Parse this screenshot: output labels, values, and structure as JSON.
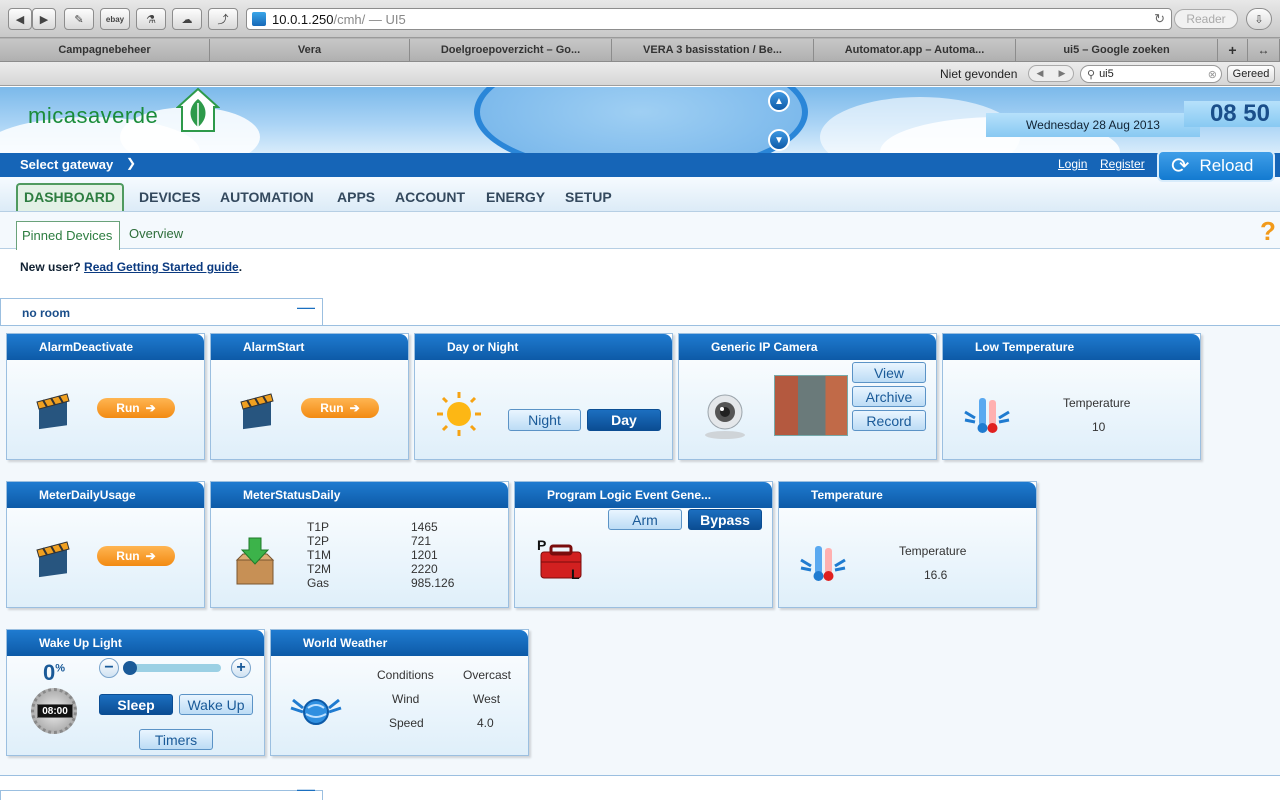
{
  "browser": {
    "url_domain": "10.0.1.250",
    "url_rest": "/cmh/ — UI5",
    "reader_label": "Reader",
    "tabs": [
      "Campagnebeheer",
      "Vera",
      "Doelgroepoverzicht – Go...",
      "VERA 3 basisstation / Be...",
      "Automator.app – Automa...",
      "ui5 – Google zoeken"
    ],
    "find_status": "Niet gevonden",
    "find_value": "ui5",
    "find_done": "Gereed"
  },
  "header": {
    "logo": "micasaverde",
    "date": "Wednesday 28 Aug 2013",
    "time": "08 50",
    "select_gateway": "Select gateway",
    "login": "Login",
    "register": "Register",
    "reload": "Reload"
  },
  "nav": {
    "tabs": [
      "DASHBOARD",
      "DEVICES",
      "AUTOMATION",
      "APPS",
      "ACCOUNT",
      "ENERGY",
      "SETUP"
    ],
    "subtabs": [
      "Pinned Devices",
      "Overview"
    ]
  },
  "notice": {
    "prefix": "New user?",
    "link": "Read Getting Started guide",
    "suffix": "."
  },
  "room": {
    "name": "no room"
  },
  "devices": {
    "alarm_deactivate": {
      "title": "AlarmDeactivate",
      "button": "Run"
    },
    "alarm_start": {
      "title": "AlarmStart",
      "button": "Run"
    },
    "day_night": {
      "title": "Day or Night",
      "night": "Night",
      "day": "Day"
    },
    "camera": {
      "title": "Generic IP Camera",
      "view": "View",
      "archive": "Archive",
      "record": "Record"
    },
    "low_temp": {
      "title": "Low Temperature",
      "label": "Temperature",
      "value": "10"
    },
    "meter_daily": {
      "title": "MeterDailyUsage",
      "button": "Run"
    },
    "meter_status": {
      "title": "MeterStatusDaily",
      "rows": [
        {
          "k": "T1P",
          "v": "1465"
        },
        {
          "k": "T2P",
          "v": "721"
        },
        {
          "k": "T1M",
          "v": "1201"
        },
        {
          "k": "T2M",
          "v": "2220"
        },
        {
          "k": "Gas",
          "v": "985.126"
        }
      ]
    },
    "program_logic": {
      "title": "Program Logic Event Gene...",
      "arm": "Arm",
      "bypass": "Bypass"
    },
    "temperature": {
      "title": "Temperature",
      "label": "Temperature",
      "value": "16.6"
    },
    "wake_up": {
      "title": "Wake Up Light",
      "level": "0",
      "unit": "%",
      "clock": "08:00",
      "level_fraction": 0,
      "sleep": "Sleep",
      "wake": "Wake Up",
      "timers": "Timers"
    },
    "weather": {
      "title": "World Weather",
      "rows": [
        {
          "k": "Conditions",
          "v": "Overcast"
        },
        {
          "k": "Wind",
          "v": "West"
        },
        {
          "k": "Speed",
          "v": "4.0"
        }
      ]
    }
  },
  "colors": {
    "brand_blue": "#1665b7",
    "orange": "#f28a12",
    "green": "#2e9a4a"
  }
}
